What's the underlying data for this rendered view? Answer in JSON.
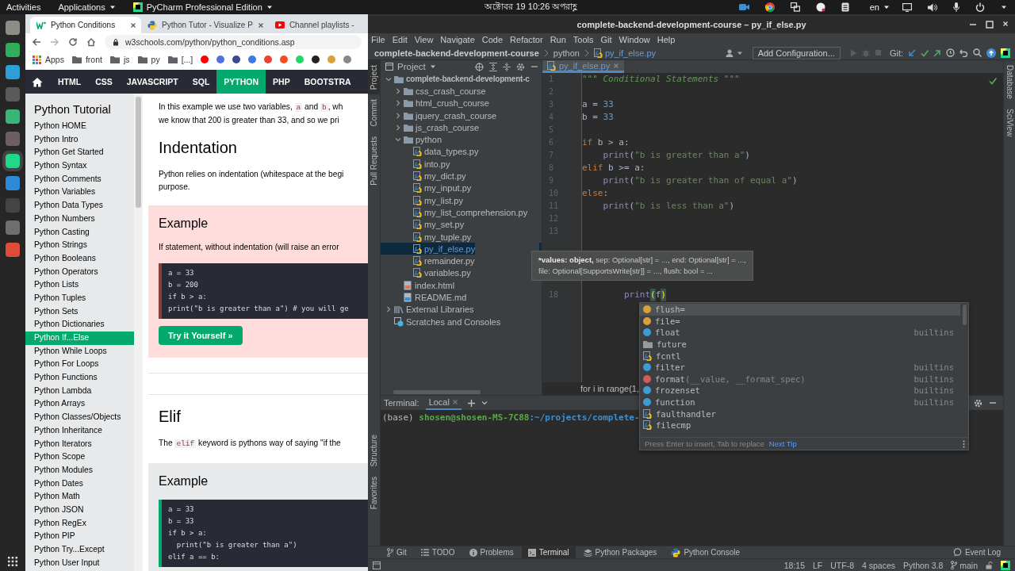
{
  "top_bar": {
    "activities": "Activities",
    "applications": "Applications",
    "app_menu": "PyCharm Professional Edition",
    "clock": "অক্টোবর 19  10:26 অপরাহ্ণ",
    "language": "en"
  },
  "browser": {
    "tabs": [
      {
        "title": "Python Conditions",
        "selected": true,
        "closable": true
      },
      {
        "title": "Python Tutor - Visualize P",
        "selected": false,
        "closable": true
      },
      {
        "title": "Channel playlists -",
        "selected": false,
        "closable": false
      }
    ],
    "address": "w3schools.com/python/python_conditions.asp",
    "bookmarks": [
      {
        "kind": "apps",
        "label": "Apps"
      },
      {
        "kind": "folder",
        "label": "front"
      },
      {
        "kind": "folder",
        "label": "js"
      },
      {
        "kind": "folder",
        "label": "py"
      },
      {
        "kind": "folder",
        "label": "[...]"
      }
    ],
    "nav": [
      {
        "label": "HTML",
        "selected": false
      },
      {
        "label": "CSS",
        "selected": false
      },
      {
        "label": "JAVASCRIPT",
        "selected": false
      },
      {
        "label": "SQL",
        "selected": false
      },
      {
        "label": "PYTHON",
        "selected": true
      },
      {
        "label": "PHP",
        "selected": false
      },
      {
        "label": "BOOTSTRA",
        "selected": false
      }
    ],
    "sidebar": {
      "title": "Python Tutorial",
      "items": [
        {
          "label": "Python HOME",
          "selected": false
        },
        {
          "label": "Python Intro",
          "selected": false
        },
        {
          "label": "Python Get Started",
          "selected": false
        },
        {
          "label": "Python Syntax",
          "selected": false
        },
        {
          "label": "Python Comments",
          "selected": false
        },
        {
          "label": "Python Variables",
          "selected": false
        },
        {
          "label": "Python Data Types",
          "selected": false
        },
        {
          "label": "Python Numbers",
          "selected": false
        },
        {
          "label": "Python Casting",
          "selected": false
        },
        {
          "label": "Python Strings",
          "selected": false
        },
        {
          "label": "Python Booleans",
          "selected": false
        },
        {
          "label": "Python Operators",
          "selected": false
        },
        {
          "label": "Python Lists",
          "selected": false
        },
        {
          "label": "Python Tuples",
          "selected": false
        },
        {
          "label": "Python Sets",
          "selected": false
        },
        {
          "label": "Python Dictionaries",
          "selected": false
        },
        {
          "label": "Python If...Else",
          "selected": true
        },
        {
          "label": "Python While Loops",
          "selected": false
        },
        {
          "label": "Python For Loops",
          "selected": false
        },
        {
          "label": "Python Functions",
          "selected": false
        },
        {
          "label": "Python Lambda",
          "selected": false
        },
        {
          "label": "Python Arrays",
          "selected": false
        },
        {
          "label": "Python Classes/Objects",
          "selected": false
        },
        {
          "label": "Python Inheritance",
          "selected": false
        },
        {
          "label": "Python Iterators",
          "selected": false
        },
        {
          "label": "Python Scope",
          "selected": false
        },
        {
          "label": "Python Modules",
          "selected": false
        },
        {
          "label": "Python Dates",
          "selected": false
        },
        {
          "label": "Python Math",
          "selected": false
        },
        {
          "label": "Python JSON",
          "selected": false
        },
        {
          "label": "Python RegEx",
          "selected": false
        },
        {
          "label": "Python PIP",
          "selected": false
        },
        {
          "label": "Python Try...Except",
          "selected": false
        },
        {
          "label": "Python User Input",
          "selected": false
        }
      ]
    },
    "content": [
      {
        "kind": "para",
        "lines": [
          [
            {
              "text": "In this example we use two variables, "
            },
            {
              "code": "a"
            },
            {
              "text": " and "
            },
            {
              "code": "b"
            },
            {
              "text": ", wh"
            }
          ],
          [
            {
              "text": "we know that 200 is greater than 33, and so we pri"
            }
          ]
        ]
      },
      {
        "kind": "heading",
        "text": "Indentation"
      },
      {
        "kind": "para",
        "lines": [
          [
            {
              "text": "Python relies on indentation (whitespace at the begi"
            }
          ],
          [
            {
              "text": "purpose."
            }
          ]
        ]
      },
      {
        "kind": "error_example",
        "heading": "Example",
        "text": "If statement, without indentation (will raise an error",
        "code": [
          "a = 33",
          "b = 200",
          "if b > a:",
          "print(\"b is greater than a\") # you will ge"
        ],
        "button": "Try it Yourself »"
      },
      {
        "kind": "rule"
      },
      {
        "kind": "rule"
      },
      {
        "kind": "heading",
        "text": "Elif"
      },
      {
        "kind": "para",
        "lines": [
          [
            {
              "text": "The "
            },
            {
              "code": "elif"
            },
            {
              "text": " keyword is pythons way of saying \"if the"
            }
          ]
        ]
      },
      {
        "kind": "example",
        "heading": "Example",
        "code": [
          "a = 33",
          "b = 33",
          "if b > a:",
          "  print(\"b is greater than a\")",
          "elif a == b:"
        ]
      }
    ]
  },
  "pycharm": {
    "title": "complete-backend-development-course – py_if_else.py",
    "menu": [
      "File",
      "Edit",
      "View",
      "Navigate",
      "Code",
      "Refactor",
      "Run",
      "Tools",
      "Git",
      "Window",
      "Help"
    ],
    "breadcrumbs": [
      "complete-backend-development-course",
      "python",
      "py_if_else.py"
    ],
    "run_config": "Add Configuration...",
    "git_label": "Git:",
    "left_tabs": [
      {
        "label": "Project",
        "selected": true
      },
      {
        "label": "Commit",
        "selected": false
      },
      {
        "label": "Pull Requests",
        "selected": false
      }
    ],
    "left_tabs_bottom": [
      {
        "label": "Structure",
        "selected": false
      },
      {
        "label": "Favorites",
        "selected": false
      }
    ],
    "right_tabs": [
      {
        "label": "Database",
        "selected": false
      },
      {
        "label": "SciView",
        "selected": false
      }
    ],
    "project_header": "Project",
    "tree": [
      {
        "label": "complete-backend-development-c",
        "kind": "folder",
        "expanded": true,
        "selected": false,
        "children": [
          {
            "label": "css_crash_course",
            "kind": "folder",
            "expanded": false,
            "selected": false
          },
          {
            "label": "html_crush_course",
            "kind": "folder",
            "expanded": false,
            "selected": false
          },
          {
            "label": "jquery_crash_course",
            "kind": "folder",
            "expanded": false,
            "selected": false
          },
          {
            "label": "js_crash_course",
            "kind": "folder",
            "expanded": false,
            "selected": false
          },
          {
            "label": "python",
            "kind": "folder",
            "expanded": true,
            "selected": false,
            "children": [
              {
                "label": "data_types.py",
                "kind": "py",
                "selected": false
              },
              {
                "label": "into.py",
                "kind": "py",
                "selected": false
              },
              {
                "label": "my_dict.py",
                "kind": "py",
                "selected": false
              },
              {
                "label": "my_input.py",
                "kind": "py",
                "selected": false
              },
              {
                "label": "my_list.py",
                "kind": "py",
                "selected": false
              },
              {
                "label": "my_list_comprehension.py",
                "kind": "py",
                "selected": false
              },
              {
                "label": "my_set.py",
                "kind": "py",
                "selected": false
              },
              {
                "label": "my_tuple.py",
                "kind": "py",
                "selected": false
              },
              {
                "label": "py_if_else.py",
                "kind": "py",
                "selected": true
              },
              {
                "label": "remainder.py",
                "kind": "py",
                "selected": false
              },
              {
                "label": "variables.py",
                "kind": "py",
                "selected": false
              }
            ]
          },
          {
            "label": "index.html",
            "kind": "html",
            "selected": false
          },
          {
            "label": "README.md",
            "kind": "md",
            "selected": false
          }
        ]
      },
      {
        "label": "External Libraries",
        "kind": "lib",
        "expanded": false,
        "selected": false
      },
      {
        "label": "Scratches and Consoles",
        "kind": "scratch",
        "selected": false
      }
    ],
    "editor_tab": {
      "label": "py_if_else.py",
      "selected": true
    },
    "lines": [
      {
        "number": "1",
        "tokens": [
          {
            "kind": "doc",
            "text": "\"\"\" Conditional Statements \"\"\""
          }
        ]
      },
      {
        "number": "2"
      },
      {
        "number": "3",
        "tokens": [
          {
            "kind": "id",
            "text": "a = "
          },
          {
            "kind": "num",
            "text": "33"
          }
        ]
      },
      {
        "number": "4",
        "tokens": [
          {
            "kind": "id",
            "text": "b = "
          },
          {
            "kind": "num",
            "text": "33"
          }
        ]
      },
      {
        "number": "5"
      },
      {
        "number": "6",
        "tokens": [
          {
            "kind": "kw",
            "text": "if"
          },
          {
            "kind": "id",
            "text": " b > a:"
          }
        ]
      },
      {
        "number": "7",
        "tokens": [
          {
            "kind": "bi",
            "text": "    print"
          },
          {
            "kind": "id",
            "text": "("
          },
          {
            "kind": "str",
            "text": "\"b is greater than a\""
          },
          {
            "kind": "id",
            "text": ")"
          }
        ]
      },
      {
        "number": "8",
        "tokens": [
          {
            "kind": "kw",
            "text": "elif"
          },
          {
            "kind": "id",
            "text": " b >= a:"
          }
        ]
      },
      {
        "number": "9",
        "tokens": [
          {
            "kind": "bi",
            "text": "    print"
          },
          {
            "kind": "id",
            "text": "("
          },
          {
            "kind": "str",
            "text": "\"b is greater than of equal a\""
          },
          {
            "kind": "id",
            "text": ")"
          }
        ]
      },
      {
        "number": "10",
        "tokens": [
          {
            "kind": "kw",
            "text": "else"
          },
          {
            "kind": "id",
            "text": ":"
          }
        ]
      },
      {
        "number": "11",
        "tokens": [
          {
            "kind": "bi",
            "text": "    print"
          },
          {
            "kind": "id",
            "text": "("
          },
          {
            "kind": "str",
            "text": "\"b is less than a\""
          },
          {
            "kind": "id",
            "text": ")"
          }
        ]
      },
      {
        "number": "12"
      },
      {
        "number": "13"
      },
      {
        "number": "18",
        "tokens": [
          {
            "kind": "bi",
            "text": "        print"
          },
          {
            "kind": "paren",
            "text": "("
          },
          {
            "kind": "id",
            "text": "f"
          },
          {
            "kind": "paren",
            "text": ")"
          }
        ]
      }
    ],
    "tooltip": {
      "bold": "*values: object,",
      "rest": " sep: Optional[str] = ..., end: Optional[str] = ...,",
      "line2": "file: Optional[SupportsWrite[str]] = ..., flush: bool = ..."
    },
    "hint_bar": "for i in range(1,",
    "completion": {
      "items": [
        {
          "kind": "param",
          "name": "flush=",
          "selected": true
        },
        {
          "kind": "param",
          "name": "file=",
          "selected": false
        },
        {
          "kind": "class",
          "name": "float",
          "source": "builtins",
          "selected": false
        },
        {
          "kind": "folder",
          "name": "future",
          "selected": false
        },
        {
          "kind": "module",
          "name": "fcntl",
          "selected": false
        },
        {
          "kind": "class",
          "name": "filter",
          "source": "builtins",
          "selected": false
        },
        {
          "kind": "function",
          "name": "format",
          "signature": "(__value, __format_spec)",
          "source": "builtins",
          "selected": false
        },
        {
          "kind": "class",
          "name": "frozenset",
          "source": "builtins",
          "selected": false
        },
        {
          "kind": "class",
          "name": "function",
          "source": "builtins",
          "selected": false
        },
        {
          "kind": "module",
          "name": "faulthandler",
          "selected": false
        },
        {
          "kind": "module",
          "name": "filecmp",
          "selected": false
        }
      ],
      "footer": "Press Enter to insert, Tab to replace",
      "tip_link": "Next Tip"
    },
    "terminal": {
      "title": "Terminal:",
      "tabs": [
        {
          "label": "Local",
          "selected": true
        }
      ],
      "prompt": {
        "env": "(base) ",
        "user": "shosen@shosen-MS-7C88",
        "path": ":~/projects/complete-"
      }
    },
    "tool_tabs": [
      {
        "label": "Git",
        "selected": false
      },
      {
        "label": "TODO",
        "selected": false
      },
      {
        "label": "Problems",
        "selected": false
      },
      {
        "label": "Terminal",
        "selected": true
      },
      {
        "label": "Python Packages",
        "selected": false
      },
      {
        "label": "Python Console",
        "selected": false
      }
    ],
    "event_log": "Event Log",
    "status": [
      "18:15",
      "LF",
      "UTF-8",
      "4 spaces",
      "Python 3.8"
    ],
    "branch": "main"
  }
}
